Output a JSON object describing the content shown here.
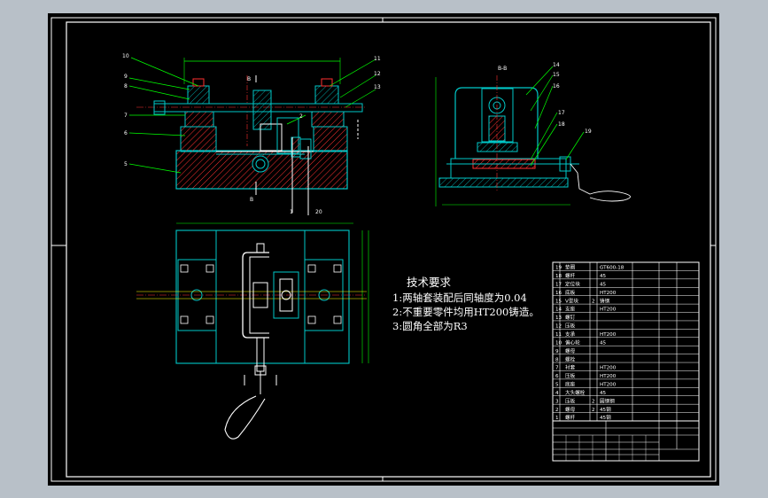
{
  "technical_requirements": {
    "title": "技术要求",
    "items": [
      "1:两轴套装配后同轴度为0.04",
      "2:不重要零件均用HT200铸造。",
      "3:圆角全部为R3"
    ]
  },
  "section_label": "B-B",
  "balloons_front": [
    "10",
    "9",
    "8",
    "7",
    "6",
    "5",
    "11",
    "12",
    "13",
    "2",
    "1",
    "20"
  ],
  "balloons_side": [
    "14",
    "15",
    "16",
    "17",
    "18",
    "19"
  ],
  "bom_rows": [
    {
      "no": "19",
      "name": "垫圈",
      "qty": "",
      "material": "GT600-18"
    },
    {
      "no": "18",
      "name": "螺杆",
      "qty": "",
      "material": "45"
    },
    {
      "no": "17",
      "name": "定位块",
      "qty": "",
      "material": "45"
    },
    {
      "no": "16",
      "name": "底板",
      "qty": "",
      "material": "HT200"
    },
    {
      "no": "15",
      "name": "V型块",
      "qty": "2",
      "material": "铸钢"
    },
    {
      "no": "14",
      "name": "支座",
      "qty": "",
      "material": "HT200"
    },
    {
      "no": "13",
      "name": "螺钉",
      "qty": "",
      "material": ""
    },
    {
      "no": "12",
      "name": "压板",
      "qty": "",
      "material": ""
    },
    {
      "no": "11",
      "name": "支承",
      "qty": "",
      "material": "HT200"
    },
    {
      "no": "10",
      "name": "偏心轮",
      "qty": "",
      "material": "45"
    },
    {
      "no": "9",
      "name": "螺母",
      "qty": "",
      "material": ""
    },
    {
      "no": "8",
      "name": "螺栓",
      "qty": "",
      "material": ""
    },
    {
      "no": "7",
      "name": "衬套",
      "qty": "",
      "material": "HT200"
    },
    {
      "no": "6",
      "name": "压板",
      "qty": "",
      "material": "HT200"
    },
    {
      "no": "5",
      "name": "底座",
      "qty": "",
      "material": "HT200"
    },
    {
      "no": "4",
      "name": "大头螺栓",
      "qty": "",
      "material": "45"
    },
    {
      "no": "3",
      "name": "压板",
      "qty": "2",
      "material": "圆钢钢"
    },
    {
      "no": "2",
      "name": "螺母",
      "qty": "2",
      "material": "45钢"
    },
    {
      "no": "1",
      "name": "螺杆",
      "qty": "",
      "material": "45钢"
    }
  ],
  "colors": {
    "background": "#000000",
    "frame": "#ffffff",
    "part": "#00c8c8",
    "hatch": "#ff3030",
    "dimension": "#00ff00",
    "centerline": "#ff3030",
    "axis": "#ffff00"
  }
}
